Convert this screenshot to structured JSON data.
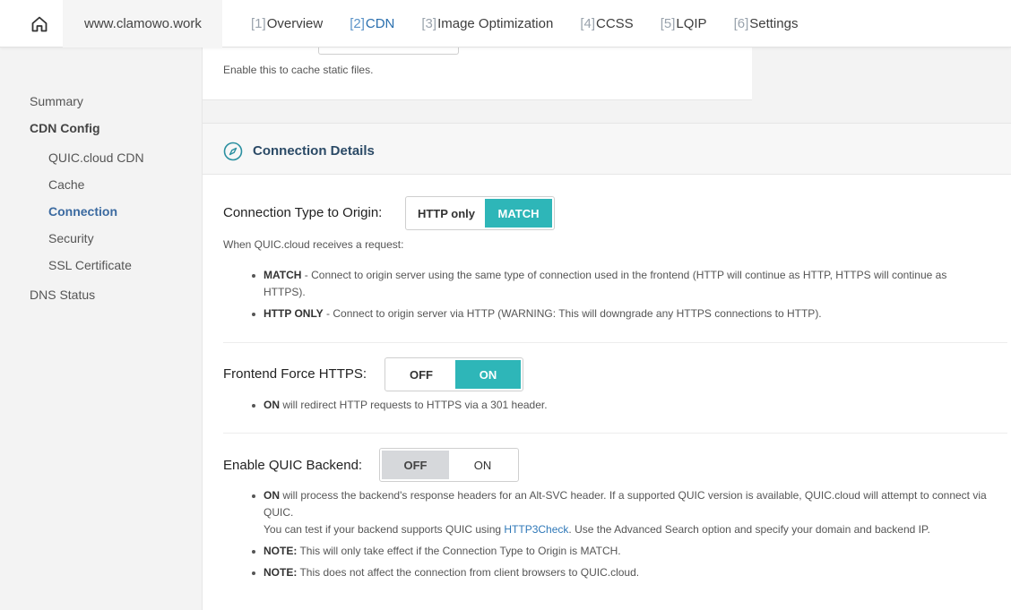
{
  "header": {
    "site": "www.clamowo.work",
    "tabs": [
      {
        "num": "[1]",
        "label": "Overview"
      },
      {
        "num": "[2]",
        "label": "CDN"
      },
      {
        "num": "[3]",
        "label": "Image Optimization"
      },
      {
        "num": "[4]",
        "label": "CCSS"
      },
      {
        "num": "[5]",
        "label": "LQIP"
      },
      {
        "num": "[6]",
        "label": "Settings"
      }
    ],
    "active_tab": 1
  },
  "sidebar": {
    "items": [
      {
        "label": "Summary"
      },
      {
        "label": "CDN Config"
      },
      {
        "label": "QUIC.cloud CDN"
      },
      {
        "label": "Cache"
      },
      {
        "label": "Connection"
      },
      {
        "label": "Security"
      },
      {
        "label": "SSL Certificate"
      },
      {
        "label": "DNS Status"
      }
    ],
    "active": "Connection"
  },
  "previous_section": {
    "description": "Enable this to cache static files."
  },
  "connection_details": {
    "title": "Connection Details",
    "connection_type": {
      "label": "Connection Type to Origin:",
      "options": [
        "HTTP only",
        "MATCH"
      ],
      "selected": "MATCH",
      "intro": "When QUIC.cloud receives a request:",
      "bullets": [
        {
          "bold": "MATCH",
          "text": " - Connect to origin server using the same type of connection used in the frontend (HTTP will continue as HTTP, HTTPS will continue as HTTPS)."
        },
        {
          "bold": "HTTP ONLY",
          "text": " - Connect to origin server via HTTP (WARNING: This will downgrade any HTTPS connections to HTTP)."
        }
      ]
    },
    "force_https": {
      "label": "Frontend Force HTTPS:",
      "options": [
        "OFF",
        "ON"
      ],
      "selected": "ON",
      "bullets": [
        {
          "bold": "ON",
          "text": " will redirect HTTP requests to HTTPS via a 301 header."
        }
      ]
    },
    "quic_backend": {
      "label": "Enable QUIC Backend:",
      "options": [
        "OFF",
        "ON"
      ],
      "selected": "OFF",
      "bullet_on": {
        "bold": "ON",
        "text": " will process the backend's response headers for an Alt-SVC header. If a supported QUIC version is available, QUIC.cloud will attempt to connect via QUIC."
      },
      "test_prefix": "You can test if your backend supports QUIC using ",
      "test_link": "HTTP3Check",
      "test_suffix": ". Use the Advanced Search option and specify your domain and backend IP.",
      "notes": [
        {
          "bold": "NOTE:",
          "text": " This will only take effect if the Connection Type to Origin is MATCH."
        },
        {
          "bold": "NOTE:",
          "text": " This does not affect the connection from client browsers to QUIC.cloud."
        }
      ]
    }
  }
}
